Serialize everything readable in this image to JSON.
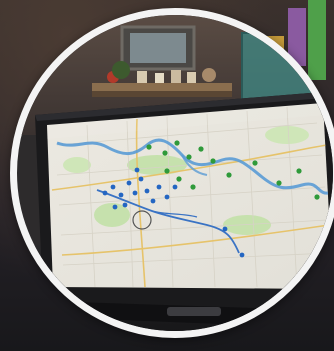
{
  "photo": {
    "subject": "tablet-showing-map",
    "colors": {
      "frame_ring": "#f4f4f4",
      "map_land": "#eae8e0",
      "river": "#5a9bd5",
      "route_line": "#3a73c4",
      "park_green": "#b9dca0",
      "marker_green": "#2f9a3a",
      "marker_blue": "#2466c2",
      "tablet_bezel": "#1a1a1c"
    }
  }
}
